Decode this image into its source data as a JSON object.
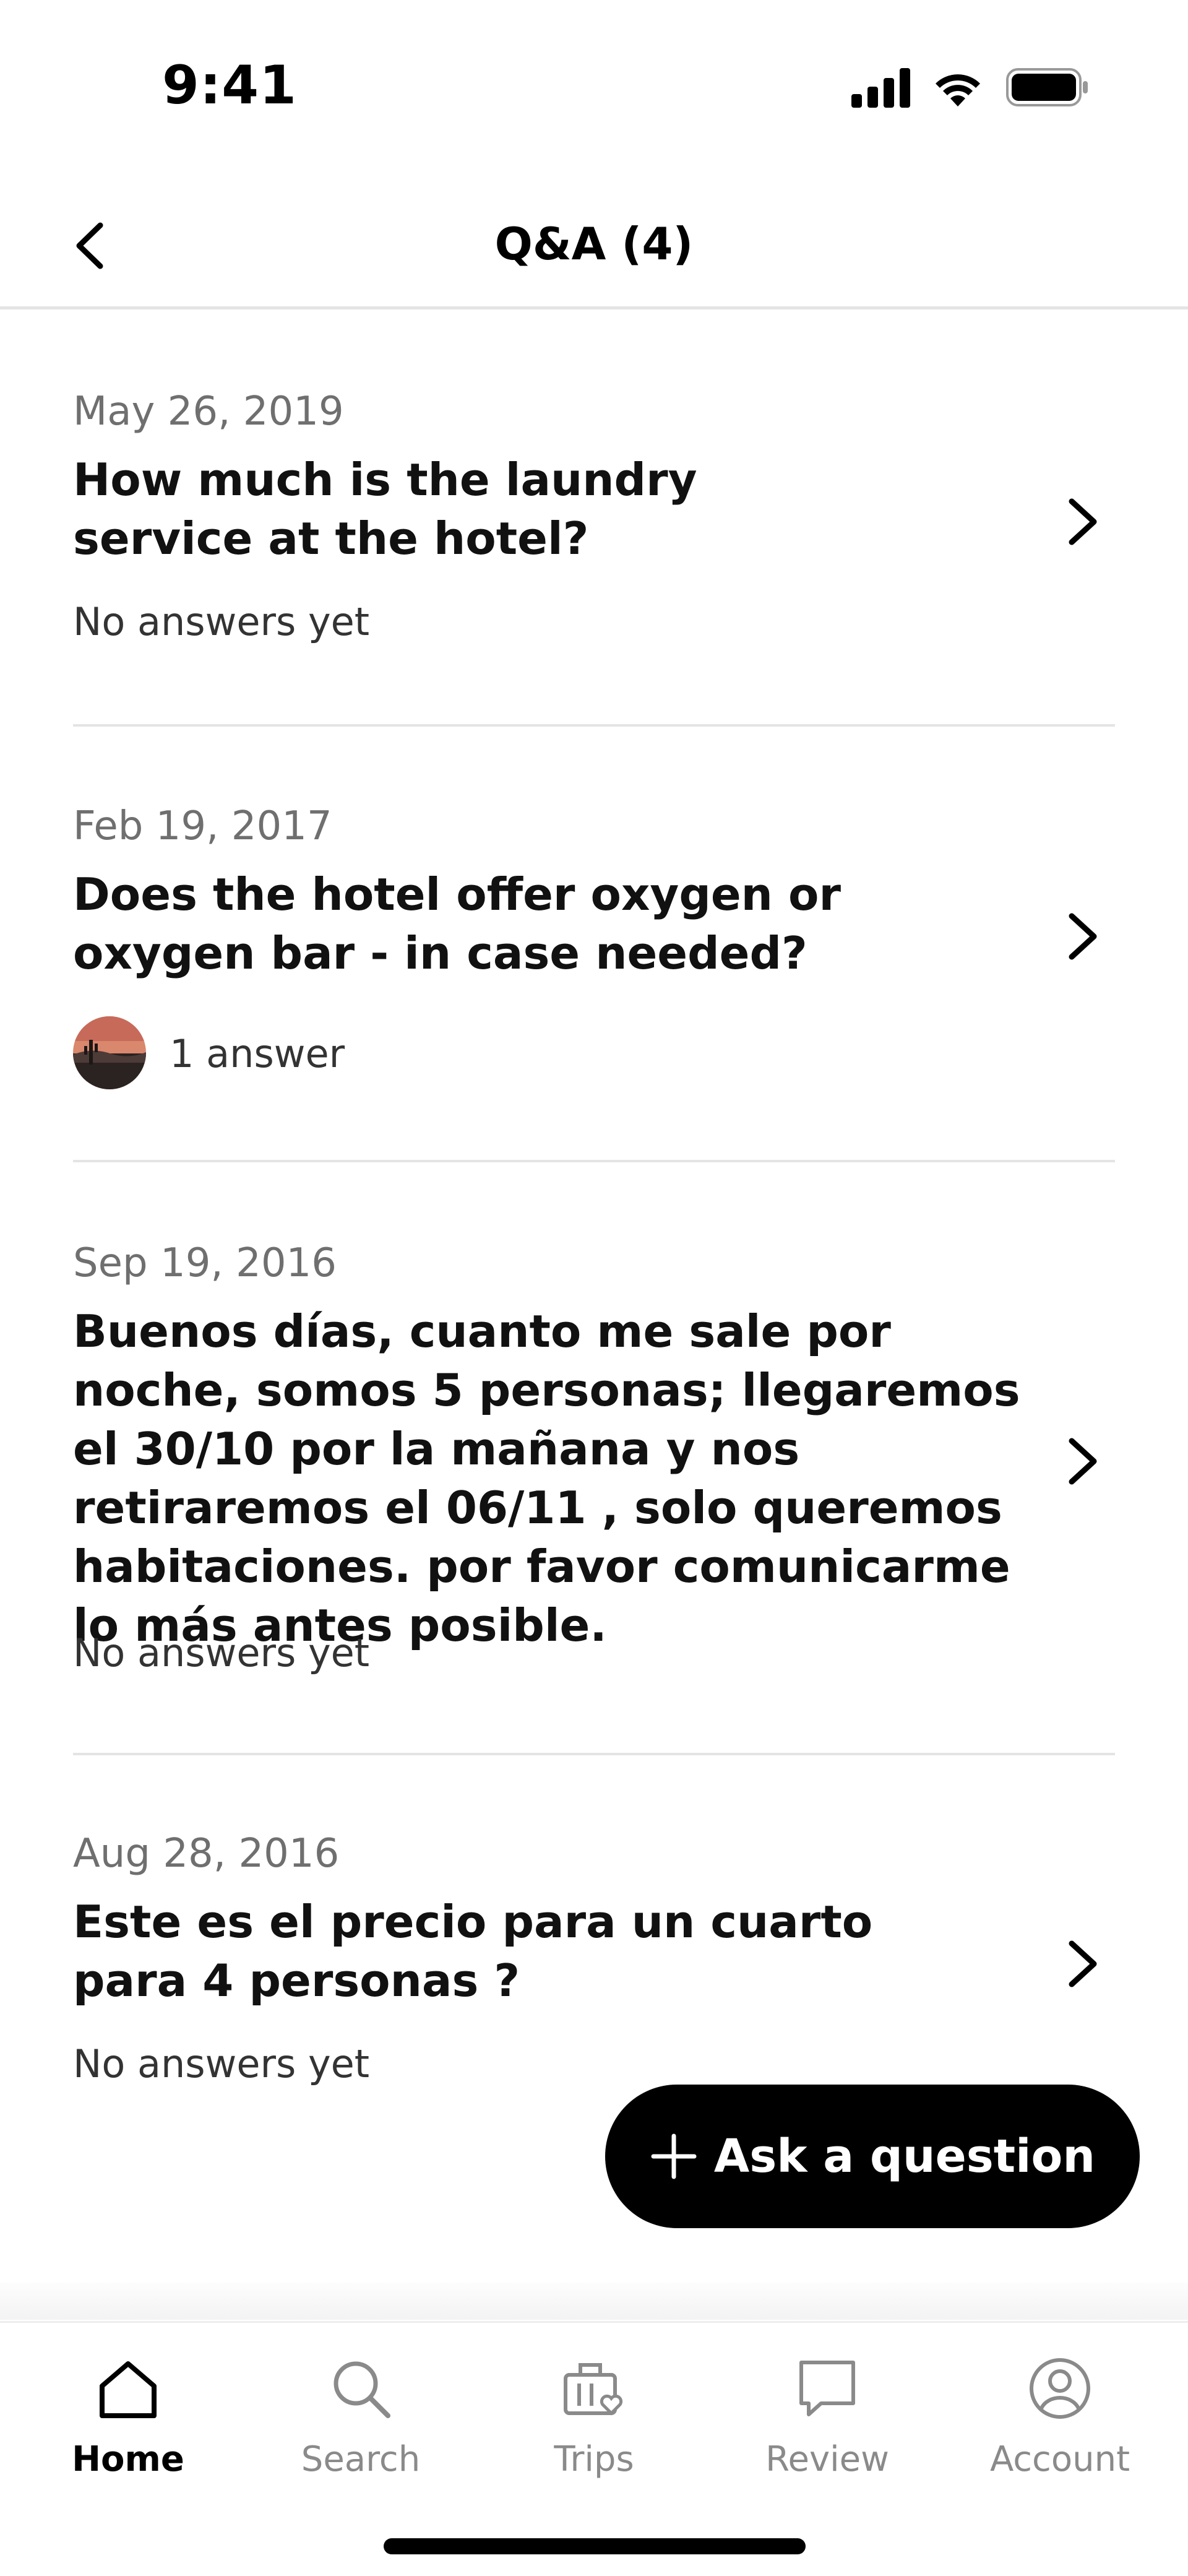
{
  "status_bar": {
    "time": "9:41",
    "icons": [
      "cellular-signal-icon",
      "wifi-icon",
      "battery-icon"
    ]
  },
  "header": {
    "title": "Q&A (4)",
    "back_icon": "chevron-left-icon"
  },
  "questions": [
    {
      "date": "May 26, 2019",
      "question": "How much is the laundry service at the hotel?",
      "status": "No answers yet",
      "has_avatar": false
    },
    {
      "date": "Feb 19, 2017",
      "question": "Does the hotel offer oxygen or oxygen bar - in case needed?",
      "status": "1 answer",
      "has_avatar": true
    },
    {
      "date": "Sep 19, 2016",
      "question": "Buenos días,  cuanto me sale por noche, somos 5 personas; llegaremos el 30/10 por la mañana y nos retiraremos el 06/11 , solo queremos habitaciones.  por favor comunicarme lo más antes posible.",
      "status": "No answers yet",
      "has_avatar": false
    },
    {
      "date": "Aug 28, 2016",
      "question": "Este es el precio para un cuarto para 4 personas ?",
      "status": "No answers yet",
      "has_avatar": false
    }
  ],
  "ask_button": {
    "label": "Ask a question",
    "icon": "plus-icon"
  },
  "bottom_nav": {
    "items": [
      {
        "label": "Home",
        "icon": "home-icon",
        "active": true
      },
      {
        "label": "Search",
        "icon": "search-icon",
        "active": false
      },
      {
        "label": "Trips",
        "icon": "suitcase-heart-icon",
        "active": false
      },
      {
        "label": "Review",
        "icon": "speech-bubble-icon",
        "active": false
      },
      {
        "label": "Account",
        "icon": "user-circle-icon",
        "active": false
      }
    ]
  },
  "colors": {
    "text_primary": "#000000",
    "text_secondary": "#6f6f6f",
    "divider": "#e4e4e4",
    "button_bg": "#000000",
    "nav_inactive": "#8a8a8a"
  }
}
